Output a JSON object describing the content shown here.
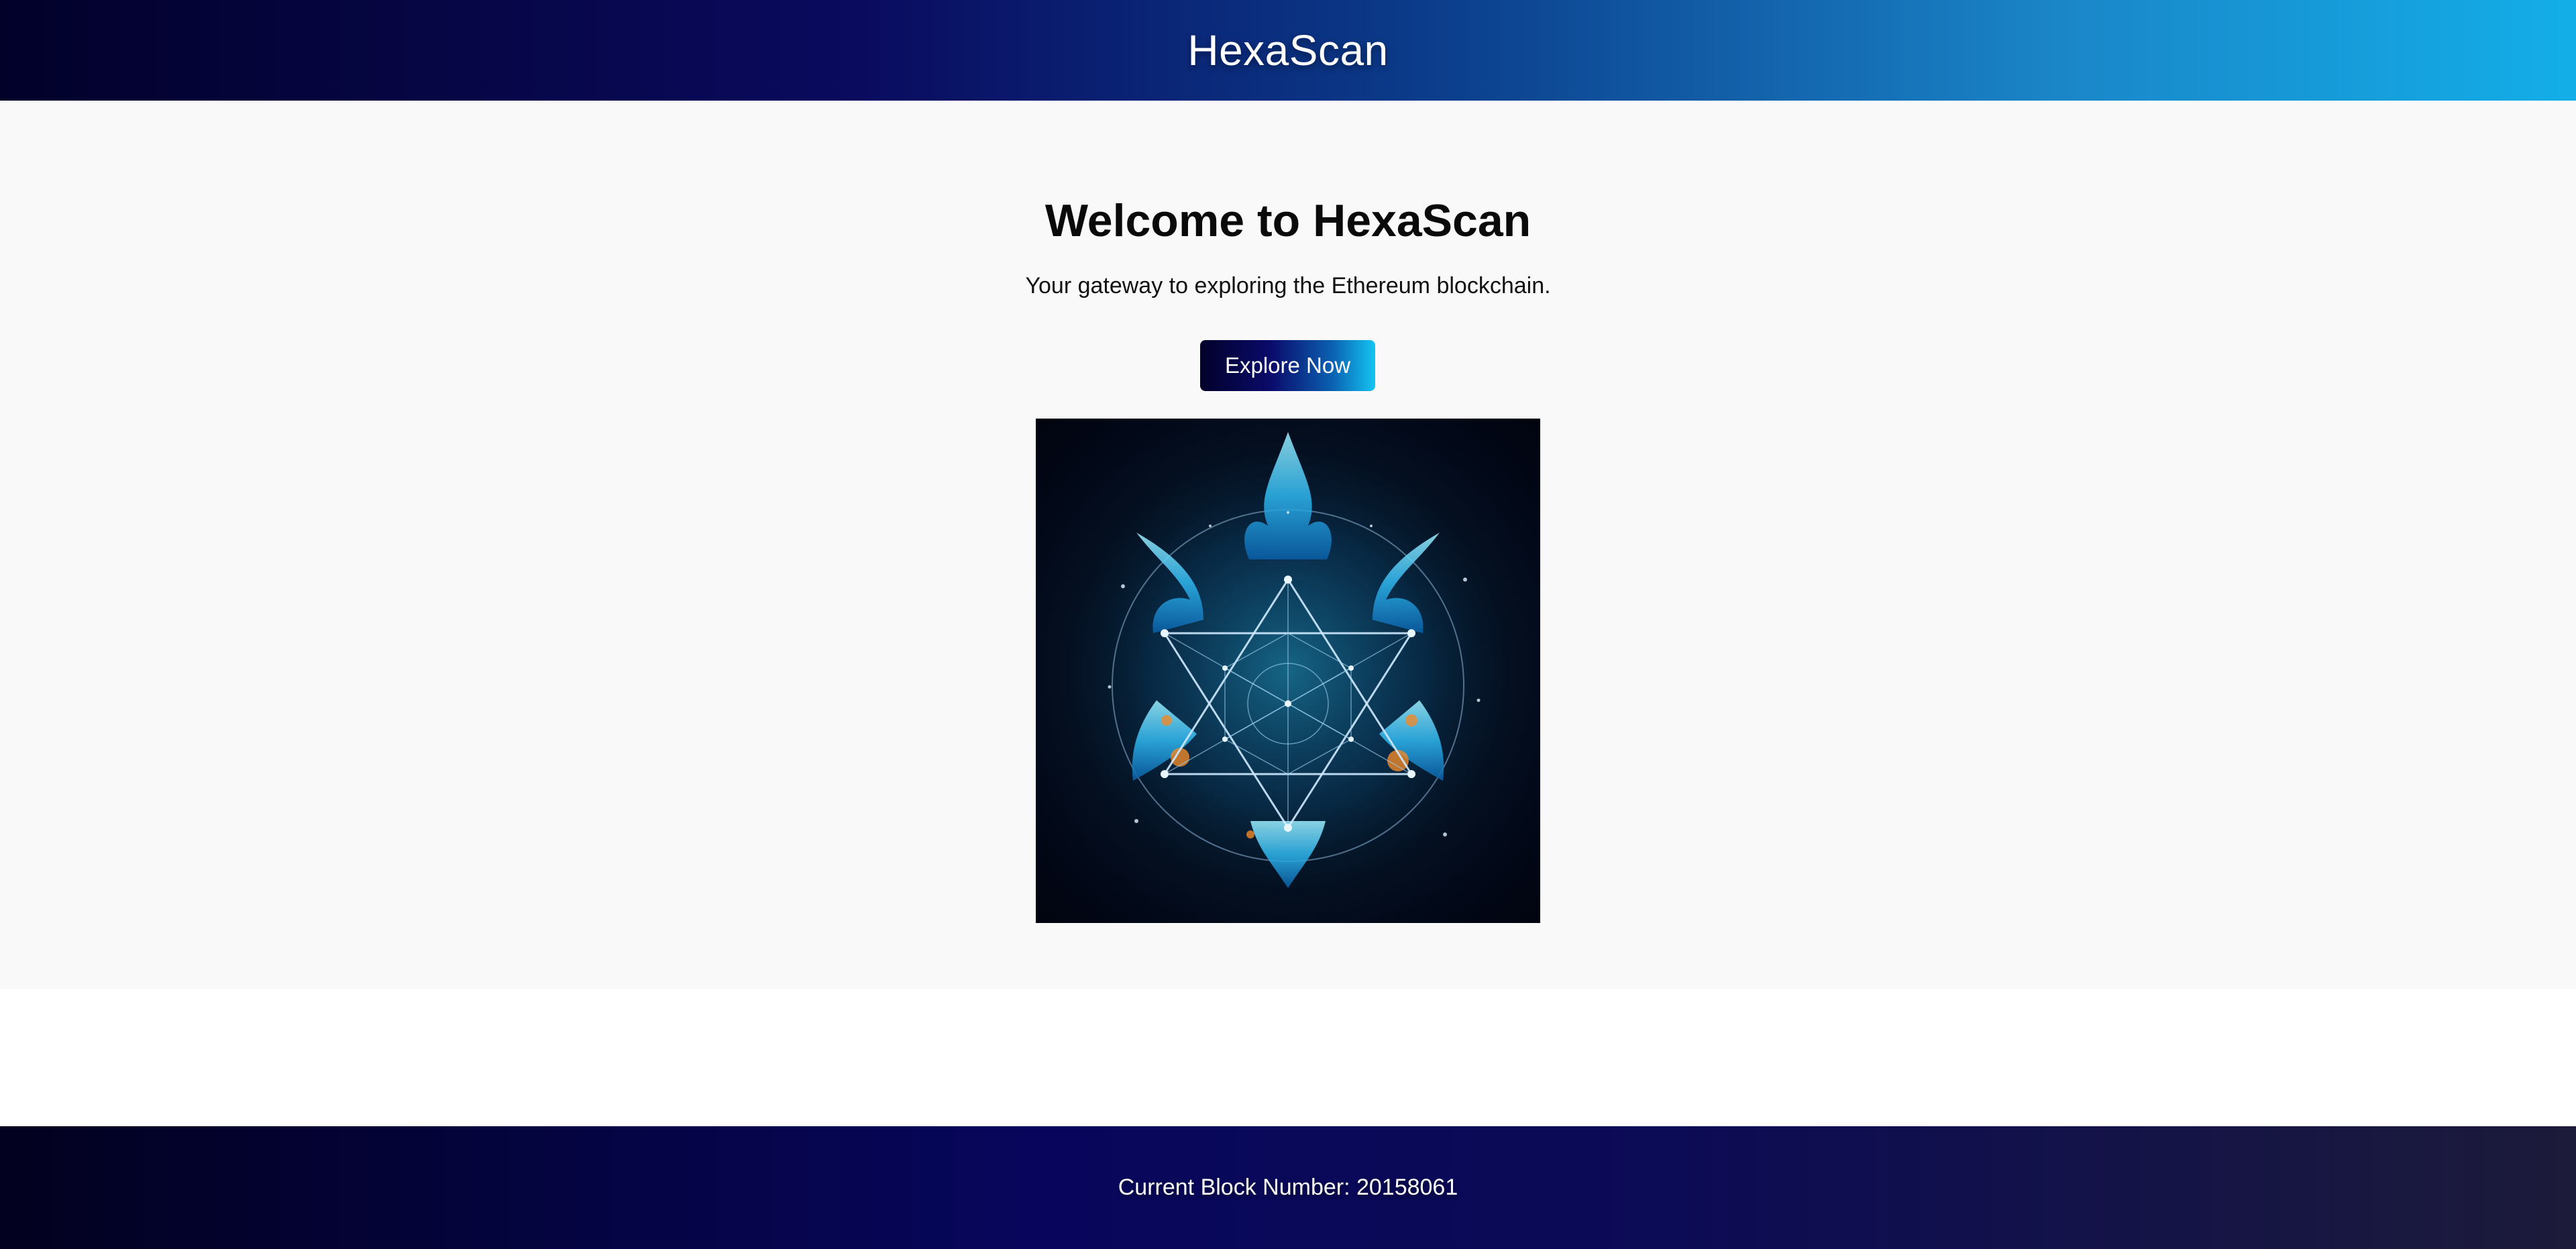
{
  "header": {
    "title": "HexaScan"
  },
  "hero": {
    "title": "Welcome to HexaScan",
    "subtitle": "Your gateway to exploring the Ethereum blockchain.",
    "button_label": "Explore Now",
    "image": {
      "description_icon": "hexagram-flame-graphic"
    }
  },
  "footer": {
    "block_label": "Current Block Number: 20158061"
  },
  "colors": {
    "header_gradient_start": "#02012a",
    "header_gradient_end": "#13aee8",
    "hero_background": "#f9f9f9",
    "footer_gradient_start": "#02011f",
    "footer_gradient_end": "#1c1b3a"
  }
}
